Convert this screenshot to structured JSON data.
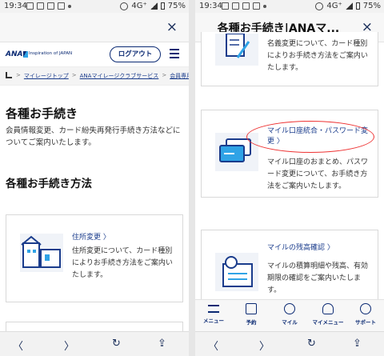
{
  "status_left": {
    "time": "19:34"
  },
  "status_right": {
    "time": "19:34"
  },
  "status": {
    "network": "4G⁺",
    "battery": "75%"
  },
  "left": {
    "close_label": "×",
    "brand": {
      "logo": "ANA",
      "tagline": "Inspiration of JAPAN",
      "logout": "ログアウト"
    },
    "breadcrumb": {
      "sep": ">",
      "items": [
        "マイレージトップ",
        "ANAマイレージクラブサービス",
        "会員専用"
      ]
    },
    "page_title": "各種お手続き",
    "lead": "会員情報変更、カード紛失再発行手続き方法などについてご案内いたします。",
    "section_title": "各種お手続き方法",
    "card": {
      "title": "住所変更 〉",
      "desc": "住所変更について、カード種別によりお手続き方法をご案内いたします。"
    },
    "nav": {
      "back": "〈",
      "forward": "〉",
      "reload": "↻",
      "share": "⇪"
    }
  },
  "right": {
    "title": "各種お手続き|ANAマ...",
    "close_label": "×",
    "cards": [
      {
        "title": "",
        "desc": "名義変更について、カード種別によりお手続き方法をご案内いたします。"
      },
      {
        "title": "マイル口座統合・パスワード変更 〉",
        "desc": "マイル口座のおまとめ、パスワード変更について、お手続き方法をご案内いたします。"
      },
      {
        "title": "マイルの残高確認 〉",
        "desc": "マイルの積算明細や残高、有効期限の確認をご案内いたします。"
      }
    ],
    "tabs": [
      "メニュー",
      "予約",
      "マイル",
      "マイメニュー",
      "サポート"
    ],
    "nav": {
      "back": "〈",
      "forward": "〉",
      "reload": "↻",
      "share": "⇪"
    }
  }
}
